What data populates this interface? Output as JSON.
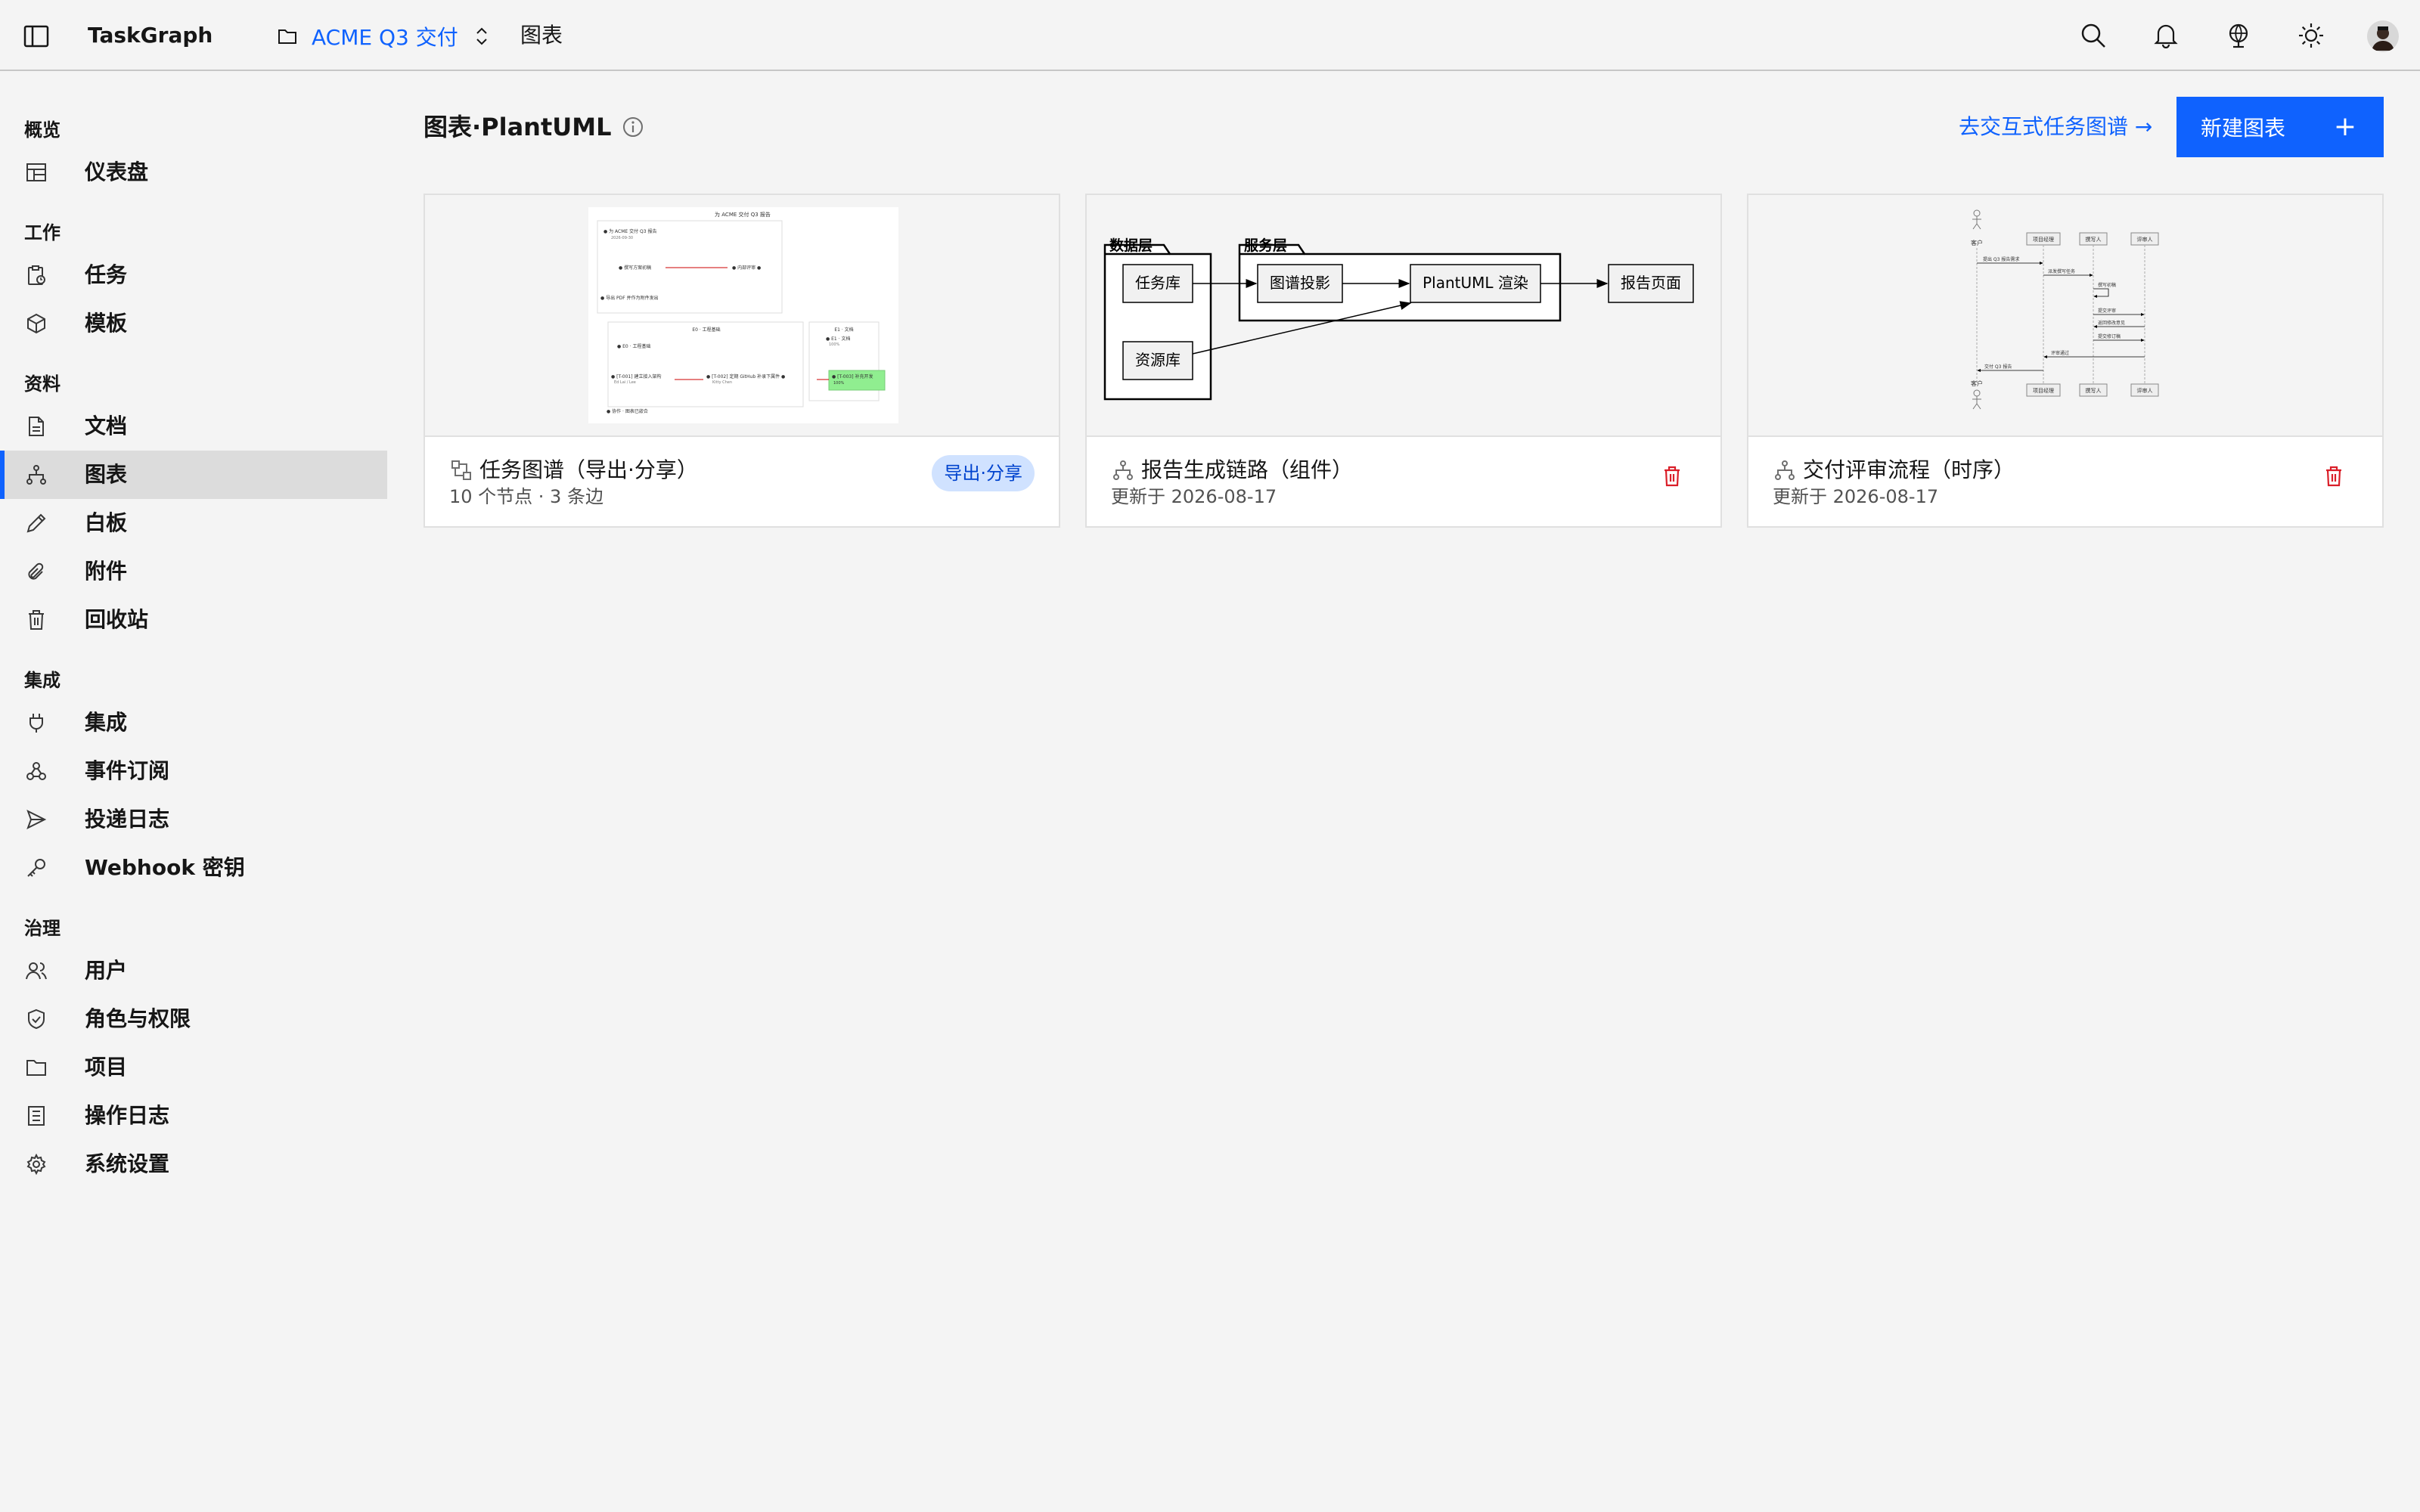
{
  "header": {
    "brand": "TaskGraph",
    "project": "ACME Q3 交付",
    "breadcrumb": "图表"
  },
  "sidebar": {
    "sections": [
      {
        "title": "概览",
        "items": [
          {
            "label": "仪表盘",
            "icon": "dashboard-icon"
          }
        ]
      },
      {
        "title": "工作",
        "items": [
          {
            "label": "任务",
            "icon": "task-icon"
          },
          {
            "label": "模板",
            "icon": "template-icon"
          }
        ]
      },
      {
        "title": "资料",
        "items": [
          {
            "label": "文档",
            "icon": "document-icon"
          },
          {
            "label": "图表",
            "icon": "diagram-icon",
            "active": true
          },
          {
            "label": "白板",
            "icon": "whiteboard-icon"
          },
          {
            "label": "附件",
            "icon": "attachment-icon"
          },
          {
            "label": "回收站",
            "icon": "trash-icon"
          }
        ]
      },
      {
        "title": "集成",
        "items": [
          {
            "label": "集成",
            "icon": "plug-icon"
          },
          {
            "label": "事件订阅",
            "icon": "webhook-icon"
          },
          {
            "label": "投递日志",
            "icon": "send-icon"
          },
          {
            "label": "Webhook 密钥",
            "icon": "key-icon"
          }
        ]
      },
      {
        "title": "治理",
        "items": [
          {
            "label": "用户",
            "icon": "users-icon"
          },
          {
            "label": "角色与权限",
            "icon": "shield-icon"
          },
          {
            "label": "项目",
            "icon": "folder-icon"
          },
          {
            "label": "操作日志",
            "icon": "log-icon"
          },
          {
            "label": "系统设置",
            "icon": "settings-icon"
          }
        ]
      }
    ]
  },
  "main": {
    "title": "图表·PlantUML",
    "goto_link": "去交互式任务图谱 →",
    "new_button": "新建图表",
    "new_button_plus": "+",
    "cards": [
      {
        "title": "任务图谱（导出·分享）",
        "subtitle": "10 个节点 · 3 条边",
        "tag": "导出·分享",
        "thumb": {
          "heading": "为 ACME 交付 Q3 报告",
          "n1": "● 为 ACME 交付 Q3 报告",
          "n1b": "2026-09-30",
          "n2": "● 撰写方案初稿",
          "n3": "● 内部评审 ●",
          "n4": "● 导出 PDF 并作为附件发出",
          "g1": "E0 · 工程基础",
          "n5": "● E0 · 工程基础",
          "n6": "● [T-001] 建立接入架构",
          "n6b": "Ed Lai / Lee",
          "n7": "● [T-002] 定期 GitHub 补录下属件 ●",
          "n7b": "Kitty Chen",
          "g2": "E1 · 文档",
          "n8": "● E1 · 文档",
          "n8b": "100%",
          "n9": "● [T-003] 补充开发",
          "n9b": "100%",
          "n10": "● 协作 · 图表已嵌合"
        }
      },
      {
        "title": "报告生成链路（组件）",
        "subtitle": "更新于 2026-08-17",
        "thumb": {
          "pkg1": "数据层",
          "pkg2": "服务层",
          "c1": "任务库",
          "c2": "资源库",
          "c3": "图谱投影",
          "c4": "PlantUML 渲染",
          "c5": "报告页面"
        }
      },
      {
        "title": "交付评审流程（时序）",
        "subtitle": "更新于 2026-08-17",
        "thumb": {
          "actor": "客户",
          "p1": "项目经理",
          "p2": "撰写人",
          "p3": "评审人",
          "m1": "提出 Q3 报告需求",
          "m2": "派发撰写任务",
          "m3": "撰写初稿",
          "m4": "提交评审",
          "m5": "返回修改意见",
          "m6": "提交修订稿",
          "m7": "评审通过",
          "m8": "交付 Q3 报告"
        }
      }
    ]
  },
  "colors": {
    "accent": "#0f62fe",
    "danger": "#da1e28",
    "tag_bg": "#d0e2ff",
    "highlight_node": "#90ee90"
  }
}
